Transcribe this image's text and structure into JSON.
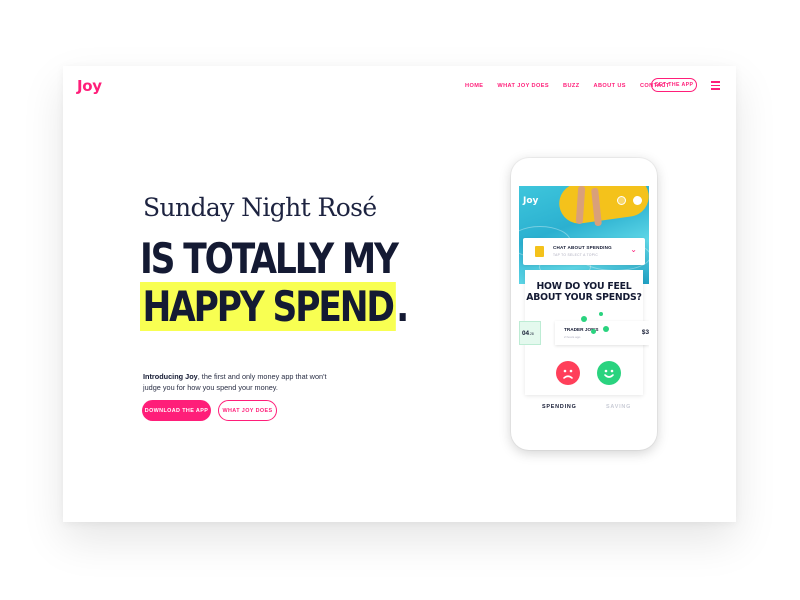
{
  "brand": {
    "logo": "Joy",
    "accent": "#ff1e79",
    "highlight": "#f8ff52",
    "navy": "#141a33"
  },
  "nav": {
    "items": [
      "HOME",
      "WHAT JOY DOES",
      "BUZZ",
      "ABOUT US",
      "CONTACT"
    ],
    "cta": "GET THE APP",
    "menu_icon": "hamburger-icon"
  },
  "hero": {
    "eyebrow": "Sunday Night Rosé",
    "headline_line1": "IS TOTALLY MY",
    "headline_line2": "HAPPY SPEND",
    "headline_period": ".",
    "intro_bold": "Introducing Joy",
    "intro_rest": ", the first and only money app that won't judge you for how you spend your money.",
    "primary_button": "DOWNLOAD THE APP",
    "secondary_button": "WHAT JOY DOES"
  },
  "phone": {
    "app_logo": "Joy",
    "chat_title": "CHAT ABOUT SPENDING",
    "chat_subtitle": "TAP TO SELECT A TOPIC",
    "question": "HOW DO YOU FEEL ABOUT YOUR SPENDS?",
    "prev_amount_main": "04",
    "prev_amount_cents": ".28",
    "transaction_name": "TRADER JOE'S",
    "transaction_date": "2 hours ago",
    "transaction_amount": "$3",
    "tab_spending": "SPENDING",
    "tab_saving": "SAVING",
    "sad_color": "#ff3f5a",
    "happy_color": "#2ad37f"
  }
}
